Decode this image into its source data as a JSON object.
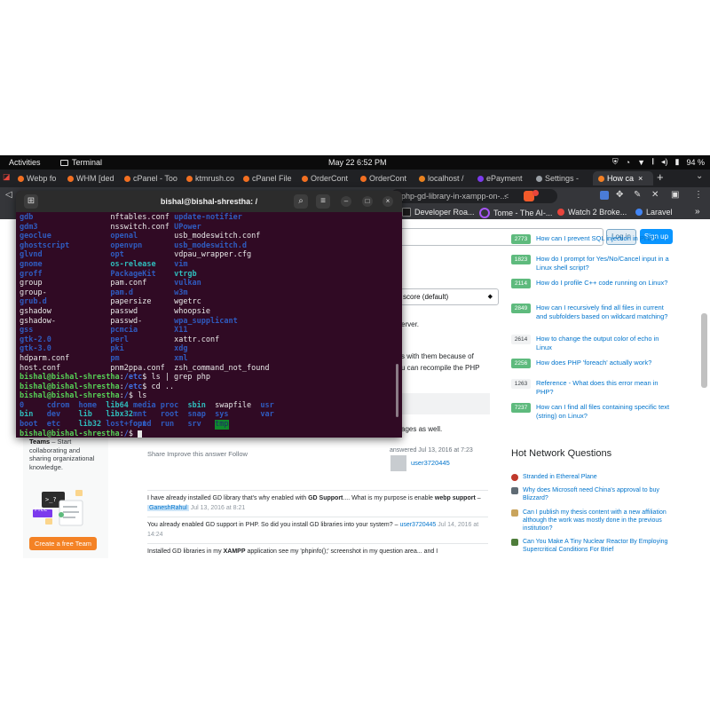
{
  "topbar": {
    "activities": "Activities",
    "app_name": "Terminal",
    "clock": "May 22  6:52 PM",
    "battery": "94 %"
  },
  "browser_tabs": [
    {
      "label": "Webp fo",
      "favicon_color": "#f26f21"
    },
    {
      "label": "WHM [ded",
      "favicon_color": "#f26f21"
    },
    {
      "label": "cPanel - Too",
      "favicon_color": "#f26f21"
    },
    {
      "label": "ktmrush.co",
      "favicon_color": "#f26f21"
    },
    {
      "label": "cPanel File",
      "favicon_color": "#f26f21"
    },
    {
      "label": "OrderCont",
      "favicon_color": "#f26f21"
    },
    {
      "label": "OrderCont",
      "favicon_color": "#f26f21"
    },
    {
      "label": "localhost /",
      "favicon_color": "#e9821f"
    },
    {
      "label": "ePayment",
      "favicon_color": "#7c3aed"
    },
    {
      "label": "Settings -",
      "favicon_color": "#9aa0a6"
    },
    {
      "label": "How ca",
      "favicon_color": "#f48024",
      "active": true
    }
  ],
  "new_tab": "+",
  "omnibox": {
    "url": "php-gd-library-in-xampp-on-..."
  },
  "bookmarks": [
    {
      "label": "Developer Roa...",
      "favicon_color": "#1a1a1a"
    },
    {
      "label": "Tome - The AI-...",
      "favicon_color": "#a855f7"
    },
    {
      "label": "Watch 2 Broke...",
      "favicon_color": "#e8453c"
    },
    {
      "label": "Laravel",
      "favicon_color": "#4285f4"
    }
  ],
  "page": {
    "login": "Log in",
    "signup": "Sign up",
    "sort_select": "score (default)",
    "answer_fragments": {
      "server": "erver.",
      "line1": "s with them because of",
      "line2": "u can recompile the PHP",
      "ages": "ages as well."
    },
    "post_menu": "Share  Improve this answer  Follow",
    "answered": "answered Jul 13, 2016 at 7:23",
    "answer_user": "user3720445",
    "comments": [
      {
        "text": "I have already installed GD library that's why enabled with ",
        "bold1": "GD Support",
        "mid": ".... What is my purpose is enable ",
        "bold2": "webp support",
        "dash": " – ",
        "user": "GaneshRahul",
        "date": "Jul 13, 2016 at 8:21"
      },
      {
        "text": "You already enabled GD support in PHP. So did you install GD libraries into your system? – ",
        "user": "user3720445",
        "date": "Jul 14, 2016 at 14:24"
      },
      {
        "pre": "Installed GD libraries in my ",
        "bold": "XAMPP",
        "post": " application see my 'phpinfo();' screenshot in my question area... and I"
      }
    ],
    "teams": {
      "title": "Teams",
      "text": " – Start collaborating and sharing organizational knowledge.",
      "free_badge": "Free",
      "cta": "Create a free Team"
    },
    "linked": [
      {
        "score": "2773",
        "accepted": true,
        "q": "How can I prevent SQL injection in PHP?"
      },
      {
        "score": "1823",
        "accepted": true,
        "q": "How do I prompt for Yes/No/Cancel input in a Linux shell script?"
      },
      {
        "score": "2114",
        "accepted": true,
        "q": "How do I profile C++ code running on Linux?"
      },
      {
        "score": "2849",
        "accepted": true,
        "q": "How can I recursively find all files in current and subfolders based on wildcard matching?"
      },
      {
        "score": "2614",
        "accepted": false,
        "q": "How to change the output color of echo in Linux"
      },
      {
        "score": "2256",
        "accepted": true,
        "q": "How does PHP 'foreach' actually work?"
      },
      {
        "score": "1263",
        "accepted": false,
        "q": "Reference - What does this error mean in PHP?"
      },
      {
        "score": "7237",
        "accepted": true,
        "q": "How can I find all files containing specific text (string) on Linux?"
      }
    ],
    "hnq_title": "Hot Network Questions",
    "hnq": [
      {
        "q": "Stranded in Ethereal Plane",
        "color": "#c0392b"
      },
      {
        "q": "Why does Microsoft need China's approval to buy Blizzard?",
        "color": "#5f6b74"
      },
      {
        "q": "Can I publish my thesis content with a new affiliation although the work was mostly done in the previous institution?",
        "color": "#c9a45c"
      },
      {
        "q": "Can You Make A Tiny Nuclear Reactor By Employing Supercritical Conditions For Brief",
        "color": "#4e7d3a"
      }
    ]
  },
  "terminal": {
    "title": "bishal@bishal-shrestha: /",
    "prompt_user": "bishal@bishal-shrestha",
    "lines": [
      [
        {
          "t": "gdb",
          "c": "dir",
          "col": 0
        },
        {
          "t": "nftables.conf",
          "c": "plain",
          "col": 20
        },
        {
          "t": "update-notifier",
          "c": "dir",
          "col": 34
        }
      ],
      [
        {
          "t": "gdm3",
          "c": "dir",
          "col": 0
        },
        {
          "t": "nsswitch.conf",
          "c": "plain",
          "col": 20
        },
        {
          "t": "UPower",
          "c": "dir",
          "col": 34
        }
      ],
      [
        {
          "t": "geoclue",
          "c": "dir",
          "col": 0
        },
        {
          "t": "openal",
          "c": "dir",
          "col": 20
        },
        {
          "t": "usb_modeswitch.conf",
          "c": "plain",
          "col": 34
        }
      ],
      [
        {
          "t": "ghostscript",
          "c": "dir",
          "col": 0
        },
        {
          "t": "openvpn",
          "c": "dir",
          "col": 20
        },
        {
          "t": "usb_modeswitch.d",
          "c": "dir",
          "col": 34
        }
      ],
      [
        {
          "t": "glvnd",
          "c": "dir",
          "col": 0
        },
        {
          "t": "opt",
          "c": "dir",
          "col": 20
        },
        {
          "t": "vdpau_wrapper.cfg",
          "c": "plain",
          "col": 34
        }
      ],
      [
        {
          "t": "gnome",
          "c": "dir",
          "col": 0
        },
        {
          "t": "os-release",
          "c": "link",
          "col": 20
        },
        {
          "t": "vim",
          "c": "dir",
          "col": 34
        }
      ],
      [
        {
          "t": "groff",
          "c": "dir",
          "col": 0
        },
        {
          "t": "PackageKit",
          "c": "dir",
          "col": 20
        },
        {
          "t": "vtrgb",
          "c": "link",
          "col": 34
        }
      ],
      [
        {
          "t": "group",
          "c": "plain",
          "col": 0
        },
        {
          "t": "pam.conf",
          "c": "plain",
          "col": 20
        },
        {
          "t": "vulkan",
          "c": "dir",
          "col": 34
        }
      ],
      [
        {
          "t": "group-",
          "c": "plain",
          "col": 0
        },
        {
          "t": "pam.d",
          "c": "dir",
          "col": 20
        },
        {
          "t": "w3m",
          "c": "dir",
          "col": 34
        }
      ],
      [
        {
          "t": "grub.d",
          "c": "dir",
          "col": 0
        },
        {
          "t": "papersize",
          "c": "plain",
          "col": 20
        },
        {
          "t": "wgetrc",
          "c": "plain",
          "col": 34
        }
      ],
      [
        {
          "t": "gshadow",
          "c": "plain",
          "col": 0
        },
        {
          "t": "passwd",
          "c": "plain",
          "col": 20
        },
        {
          "t": "whoopsie",
          "c": "plain",
          "col": 34
        }
      ],
      [
        {
          "t": "gshadow-",
          "c": "plain",
          "col": 0
        },
        {
          "t": "passwd-",
          "c": "plain",
          "col": 20
        },
        {
          "t": "wpa_supplicant",
          "c": "dir",
          "col": 34
        }
      ],
      [
        {
          "t": "gss",
          "c": "dir",
          "col": 0
        },
        {
          "t": "pcmcia",
          "c": "dir",
          "col": 20
        },
        {
          "t": "X11",
          "c": "dir",
          "col": 34
        }
      ],
      [
        {
          "t": "gtk-2.0",
          "c": "dir",
          "col": 0
        },
        {
          "t": "perl",
          "c": "dir",
          "col": 20
        },
        {
          "t": "xattr.conf",
          "c": "plain",
          "col": 34
        }
      ],
      [
        {
          "t": "gtk-3.0",
          "c": "dir",
          "col": 0
        },
        {
          "t": "pki",
          "c": "dir",
          "col": 20
        },
        {
          "t": "xdg",
          "c": "dir",
          "col": 34
        }
      ],
      [
        {
          "t": "hdparm.conf",
          "c": "plain",
          "col": 0
        },
        {
          "t": "pm",
          "c": "dir",
          "col": 20
        },
        {
          "t": "xml",
          "c": "dir",
          "col": 34
        }
      ],
      [
        {
          "t": "host.conf",
          "c": "plain",
          "col": 0
        },
        {
          "t": "pnm2ppa.conf",
          "c": "plain",
          "col": 20
        },
        {
          "t": "zsh_command_not_found",
          "c": "plain",
          "col": 34
        }
      ],
      [
        {
          "t": "bishal@bishal-shrestha",
          "c": "user",
          "col": 0
        },
        {
          "t": ":",
          "c": "plain",
          "col": 22
        },
        {
          "t": "/etc",
          "c": "path",
          "col": 23
        },
        {
          "t": "$ ls | grep php",
          "c": "plain",
          "col": 27
        }
      ],
      [
        {
          "t": "bishal@bishal-shrestha",
          "c": "user",
          "col": 0
        },
        {
          "t": ":",
          "c": "plain",
          "col": 22
        },
        {
          "t": "/etc",
          "c": "path",
          "col": 23
        },
        {
          "t": "$ cd ..",
          "c": "plain",
          "col": 27
        }
      ],
      [
        {
          "t": "bishal@bishal-shrestha",
          "c": "user",
          "col": 0
        },
        {
          "t": ":",
          "c": "plain",
          "col": 22
        },
        {
          "t": "/",
          "c": "path",
          "col": 23
        },
        {
          "t": "$ ls",
          "c": "plain",
          "col": 24
        }
      ],
      [
        {
          "t": "0",
          "c": "dir",
          "col": 0
        },
        {
          "t": "cdrom",
          "c": "dir",
          "col": 6
        },
        {
          "t": "home",
          "c": "dir",
          "col": 13
        },
        {
          "t": "lib64",
          "c": "link",
          "col": 19
        },
        {
          "t": "media",
          "c": "dir",
          "col": 25
        },
        {
          "t": "proc",
          "c": "dir",
          "col": 31
        },
        {
          "t": "sbin",
          "c": "link",
          "col": 37
        },
        {
          "t": "swapfile",
          "c": "plain",
          "col": 43
        },
        {
          "t": "usr",
          "c": "dir",
          "col": 53
        }
      ],
      [
        {
          "t": "bin",
          "c": "link",
          "col": 0
        },
        {
          "t": "dev",
          "c": "dir",
          "col": 6
        },
        {
          "t": "lib",
          "c": "link",
          "col": 13
        },
        {
          "t": "libx32",
          "c": "link",
          "col": 19
        },
        {
          "t": "mnt",
          "c": "dir",
          "col": 25
        },
        {
          "t": "root",
          "c": "dir",
          "col": 31
        },
        {
          "t": "snap",
          "c": "dir",
          "col": 37
        },
        {
          "t": "sys",
          "c": "dir",
          "col": 43
        },
        {
          "t": "var",
          "c": "dir",
          "col": 53
        }
      ],
      [
        {
          "t": "boot",
          "c": "dir",
          "col": 0
        },
        {
          "t": "etc",
          "c": "dir",
          "col": 6
        },
        {
          "t": "lib32",
          "c": "link",
          "col": 13
        },
        {
          "t": "lost+found",
          "c": "dir",
          "col": 19
        },
        {
          "t": "opt",
          "c": "dir",
          "col": 25
        },
        {
          "t": "run",
          "c": "dir",
          "col": 31
        },
        {
          "t": "srv",
          "c": "dir",
          "col": 37
        },
        {
          "t": "tmp",
          "c": "tmp",
          "col": 43
        }
      ],
      [
        {
          "t": "bishal@bishal-shrestha",
          "c": "user",
          "col": 0
        },
        {
          "t": ":",
          "c": "plain",
          "col": 22
        },
        {
          "t": "/",
          "c": "path",
          "col": 23
        },
        {
          "t": "$ ",
          "c": "plain",
          "col": 24
        }
      ]
    ]
  }
}
